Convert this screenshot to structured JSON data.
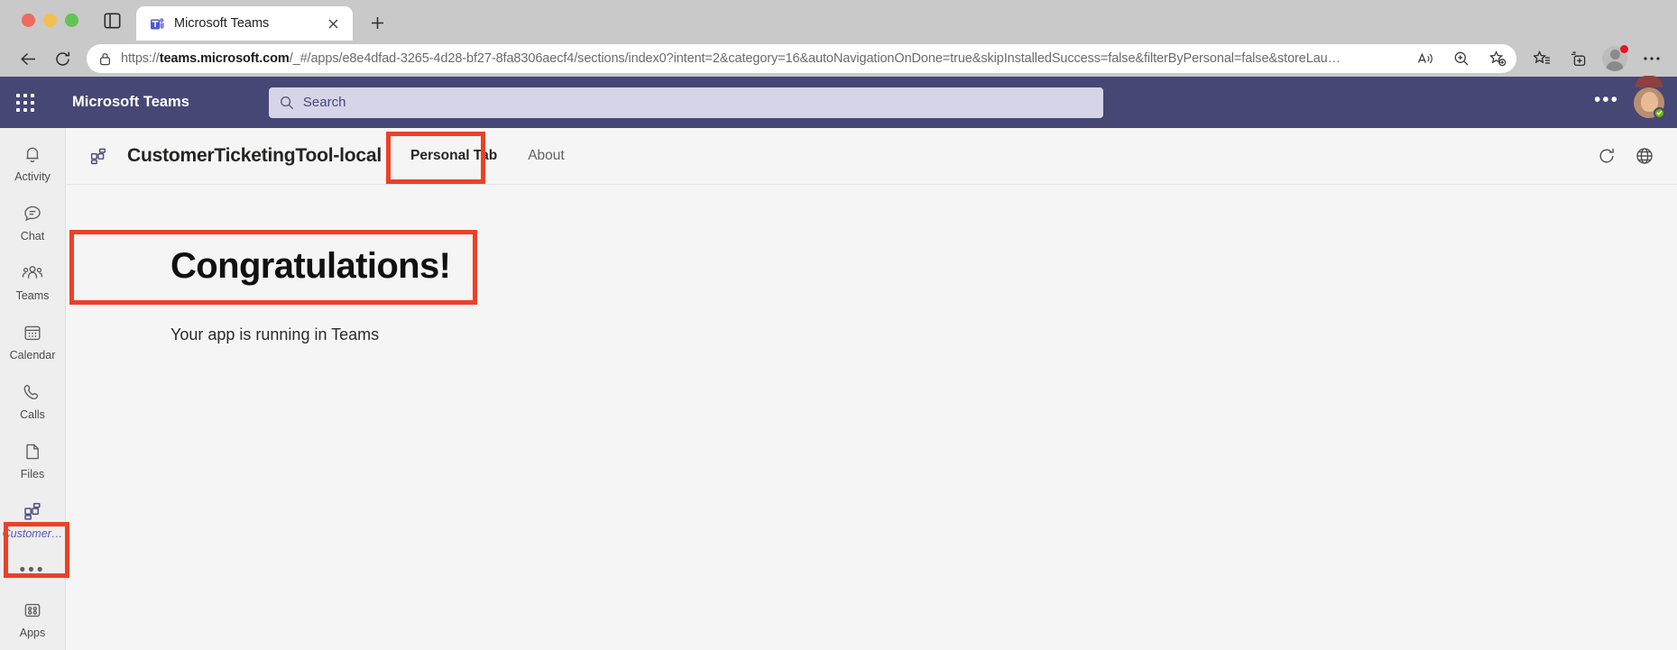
{
  "browser": {
    "tab": {
      "title": "Microsoft Teams",
      "favicon": "teams-favicon",
      "close_label": "×"
    },
    "new_tab_label": "+",
    "toolbar": {
      "back_icon": "back-arrow-icon",
      "reload_icon": "reload-icon",
      "url_prefix": "https://",
      "url_domain": "teams.microsoft.com",
      "url_path": "/_#/apps/e8e4dfad-3265-4d28-bf27-8fa8306aecf4/sections/index0?intent=2&category=16&autoNavigationOnDone=true&skipInstalledSuccess=false&filterByPersonal=false&storeLau…",
      "lock_icon": "lock-icon",
      "read_aloud_icon": "read-aloud-icon",
      "zoom_icon": "zoom-in-icon",
      "add_favorite_icon": "add-favorite-icon",
      "favorites_icon": "favorites-icon",
      "collections_icon": "collections-icon",
      "profile_icon": "profile-avatar-icon",
      "settings_icon": "more-settings-icon"
    },
    "sidebar_toggle_icon": "sidebar-toggle-icon"
  },
  "teams": {
    "waffle_icon": "app-launcher-icon",
    "title": "Microsoft Teams",
    "search": {
      "placeholder": "Search",
      "icon": "search-icon"
    },
    "header_more_label": "•••",
    "avatar_name": "user-avatar",
    "presence": "available",
    "rail": [
      {
        "label": "Activity",
        "icon": "bell-icon",
        "active": false
      },
      {
        "label": "Chat",
        "icon": "chat-icon",
        "active": false
      },
      {
        "label": "Teams",
        "icon": "teams-people-icon",
        "active": false
      },
      {
        "label": "Calendar",
        "icon": "calendar-icon",
        "active": false
      },
      {
        "label": "Calls",
        "icon": "phone-icon",
        "active": false
      },
      {
        "label": "Files",
        "icon": "file-icon",
        "active": false
      },
      {
        "label": "Customer…",
        "icon": "app-tiles-icon",
        "active": true
      }
    ],
    "rail_more_label": "•••",
    "rail_apps": {
      "label": "Apps",
      "icon": "apps-grid-icon"
    }
  },
  "app": {
    "icon": "app-tiles-icon",
    "title": "CustomerTicketingTool-local",
    "tabs": [
      {
        "label": "Personal Tab",
        "selected": true
      },
      {
        "label": "About",
        "selected": false
      }
    ],
    "refresh_icon": "refresh-icon",
    "globe_icon": "globe-icon",
    "stage": {
      "heading": "Congratulations!",
      "subtext": "Your app is running in Teams"
    }
  },
  "annotations": {
    "highlight_color": "#ec4126",
    "boxes": [
      {
        "name": "personal-tab-highlight"
      },
      {
        "name": "congratulations-highlight"
      },
      {
        "name": "customer-app-rail-highlight"
      }
    ]
  }
}
